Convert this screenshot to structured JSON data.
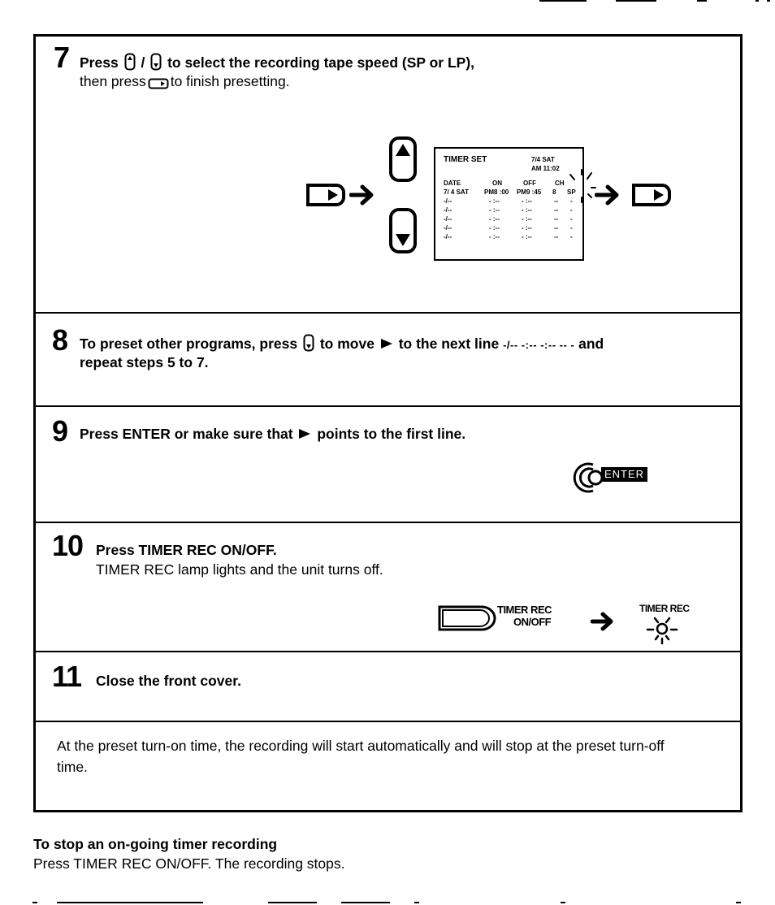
{
  "steps": [
    {
      "number": "7",
      "title_parts": [
        "Press",
        "/",
        "to select the recording tape speed (SP or LP),"
      ],
      "subtitle_parts": [
        "then press",
        "to finish presetting."
      ],
      "icons": [
        "up-button-icon",
        "down-button-icon",
        "set-button-icon"
      ]
    },
    {
      "number": "8",
      "title_parts": [
        "To preset other programs, press",
        "to move",
        "to the next line",
        "-/-- -:-- -:-- -- -",
        "and"
      ],
      "title_line2": "repeat steps 5 to 7.",
      "icons": [
        "down-button-icon",
        "pointer-triangle-icon"
      ]
    },
    {
      "number": "9",
      "title_parts": [
        "Press ENTER or make sure that",
        "points to the first line."
      ],
      "icons": [
        "pointer-triangle-icon"
      ],
      "button_label": "ENTER"
    },
    {
      "number": "10",
      "title": "Press TIMER REC ON/OFF.",
      "subtitle": "TIMER REC lamp lights and the unit turns off.",
      "button_label_line1": "TIMER REC",
      "button_label_line2": "ON/OFF",
      "lamp_label": "TIMER REC"
    },
    {
      "number": "11",
      "title": "Close the front cover."
    }
  ],
  "osd": {
    "title": "TIMER SET",
    "date": "7/4  SAT",
    "time": "AM 11:02",
    "headers": [
      "DATE",
      "ON",
      "OFF",
      "CH"
    ],
    "rows": [
      [
        "7/ 4 SAT",
        "PM8 :00",
        "PM9 :45",
        "8",
        "SP"
      ],
      [
        "-/--",
        "- :--",
        "- :--",
        "--",
        "-"
      ],
      [
        "-/--",
        "- :--",
        "- :--",
        "--",
        "-"
      ],
      [
        "-/--",
        "- :--",
        "- :--",
        "--",
        "-"
      ],
      [
        "-/--",
        "- :--",
        "- :--",
        "--",
        "-"
      ],
      [
        "-/--",
        "- :--",
        "- :--",
        "--",
        "-"
      ]
    ]
  },
  "note": "At the preset turn-on time, the recording will start automatically and will stop at the preset turn-off time.",
  "footer": {
    "title": "To stop an on-going timer recording",
    "text": "Press TIMER REC ON/OFF. The recording stops."
  }
}
